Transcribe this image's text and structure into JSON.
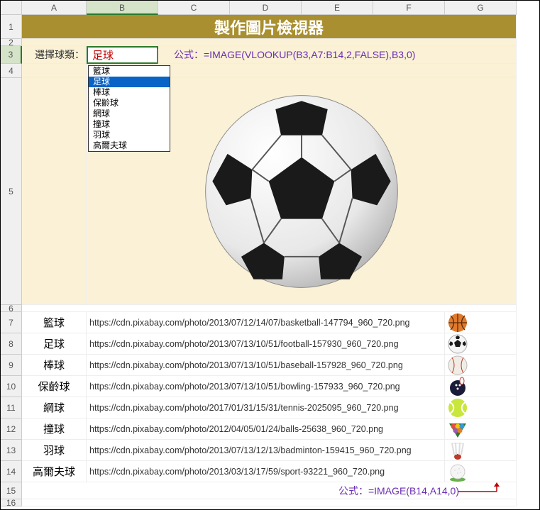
{
  "columns": [
    "A",
    "B",
    "C",
    "D",
    "E",
    "F",
    "G"
  ],
  "row_heights": {
    "1": 34,
    "2": 10,
    "3": 25,
    "4": 20,
    "5": 320,
    "6": 10,
    "7": 30,
    "8": 30,
    "9": 30,
    "10": 30,
    "11": 30,
    "12": 30,
    "13": 30,
    "14": 30,
    "15": 24,
    "16": 10
  },
  "title": "製作圖片檢視器",
  "selector": {
    "label": "選擇球類：",
    "value": "足球",
    "formula_label": "公式：=IMAGE(VLOOKUP(B3,A7:B14,2,FALSE),B3,0)",
    "options": [
      "籃球",
      "足球",
      "棒球",
      "保齡球",
      "網球",
      "撞球",
      "羽球",
      "高爾夫球"
    ],
    "selected_index": 1
  },
  "data_rows": [
    {
      "name": "籃球",
      "url": "https://cdn.pixabay.com/photo/2013/07/12/14/07/basketball-147794_960_720.png",
      "icon": "basketball"
    },
    {
      "name": "足球",
      "url": "https://cdn.pixabay.com/photo/2013/07/13/10/51/football-157930_960_720.png",
      "icon": "soccer"
    },
    {
      "name": "棒球",
      "url": "https://cdn.pixabay.com/photo/2013/07/13/10/51/baseball-157928_960_720.png",
      "icon": "baseball"
    },
    {
      "name": "保齡球",
      "url": "https://cdn.pixabay.com/photo/2013/07/13/10/51/bowling-157933_960_720.png",
      "icon": "bowling"
    },
    {
      "name": "網球",
      "url": "https://cdn.pixabay.com/photo/2017/01/31/15/31/tennis-2025095_960_720.png",
      "icon": "tennis"
    },
    {
      "name": "撞球",
      "url": "https://cdn.pixabay.com/photo/2012/04/05/01/24/balls-25638_960_720.png",
      "icon": "billiards"
    },
    {
      "name": "羽球",
      "url": "https://cdn.pixabay.com/photo/2013/07/13/12/13/badminton-159415_960_720.png",
      "icon": "badminton"
    },
    {
      "name": "高爾夫球",
      "url": "https://cdn.pixabay.com/photo/2013/03/13/17/59/sport-93221_960_720.png",
      "icon": "golf"
    }
  ],
  "bottom_formula": "公式：=IMAGE(B14,A14,0)"
}
